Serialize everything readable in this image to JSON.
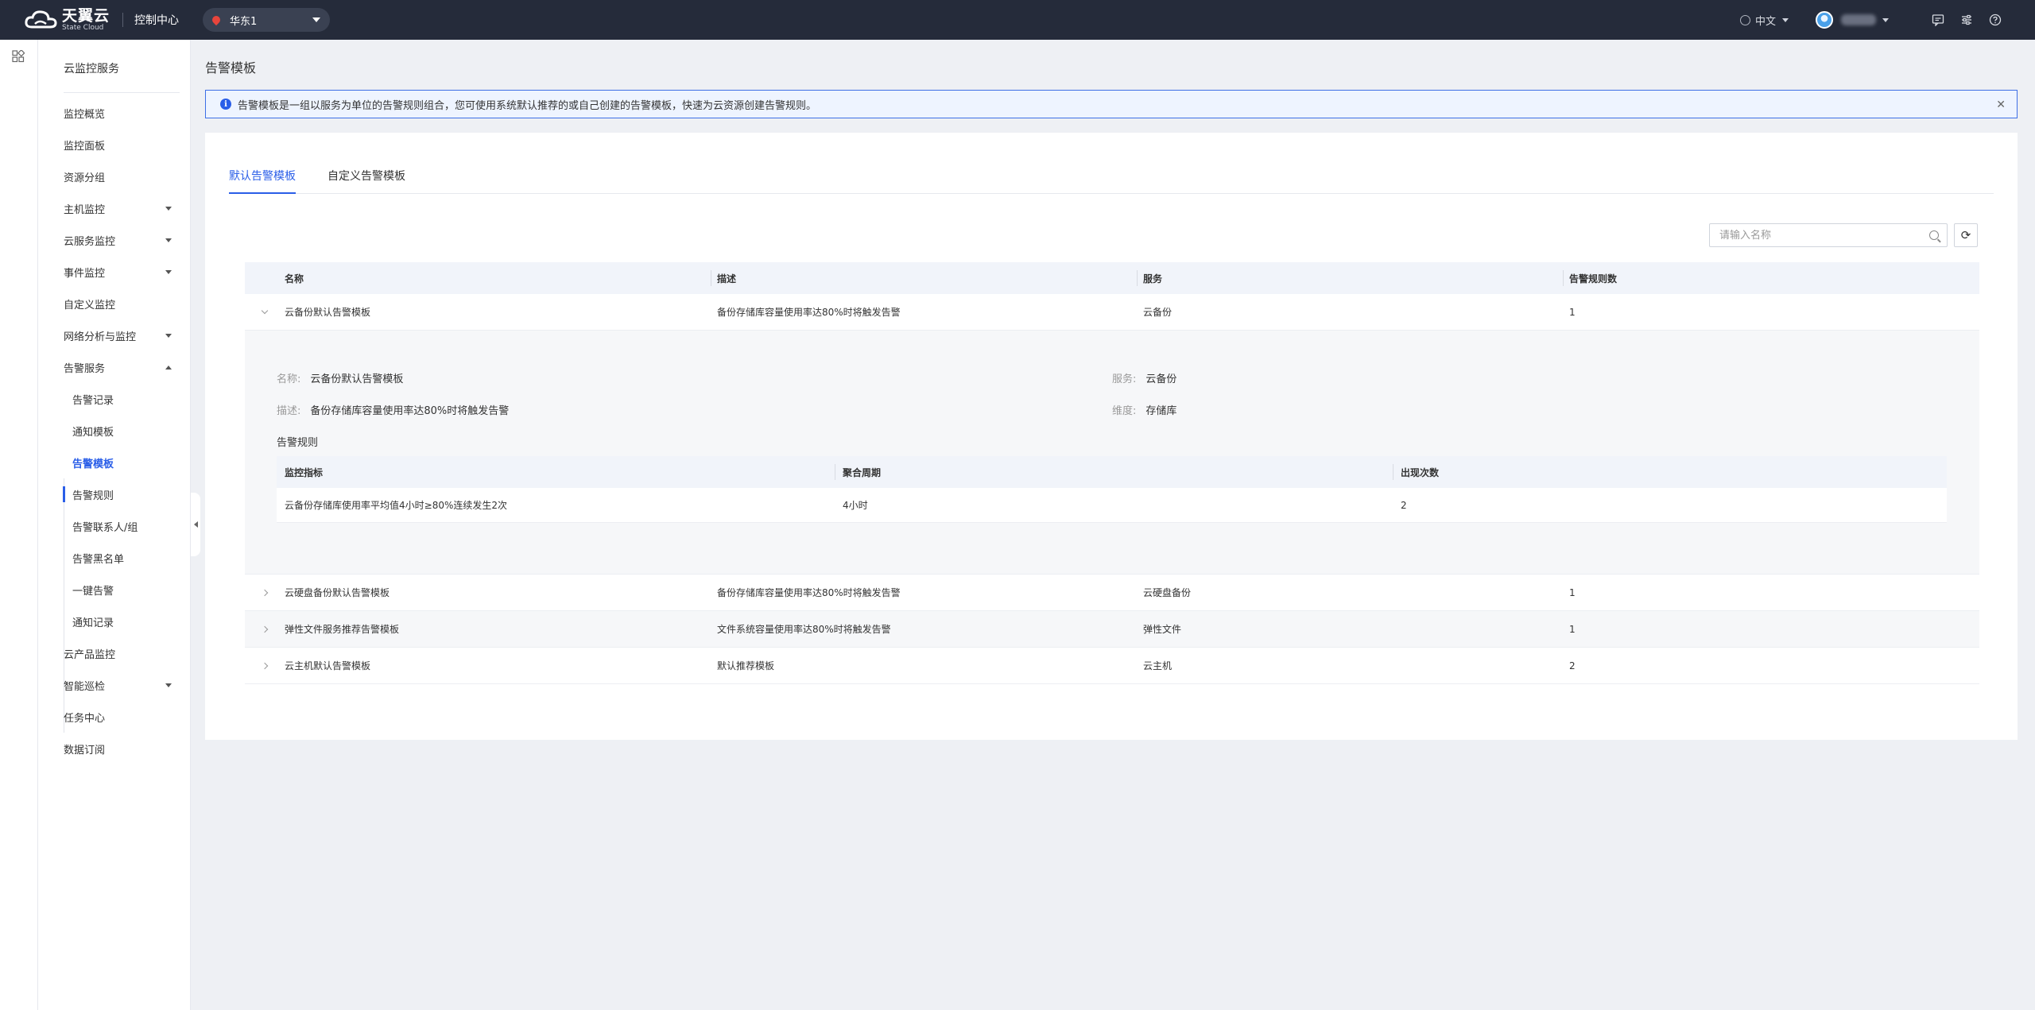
{
  "topbar": {
    "logo_main": "天翼云",
    "logo_sub": "State Cloud",
    "console_title": "控制中心",
    "region": "华东1",
    "language": "中文"
  },
  "sidebar": {
    "title": "云监控服务",
    "items": [
      {
        "label": "监控概览"
      },
      {
        "label": "监控面板"
      },
      {
        "label": "资源分组"
      },
      {
        "label": "主机监控"
      },
      {
        "label": "云服务监控"
      },
      {
        "label": "事件监控"
      },
      {
        "label": "自定义监控"
      },
      {
        "label": "网络分析与监控"
      },
      {
        "label": "告警服务"
      },
      {
        "label": "告警记录"
      },
      {
        "label": "通知模板"
      },
      {
        "label": "告警模板"
      },
      {
        "label": "告警规则"
      },
      {
        "label": "告警联系人/组"
      },
      {
        "label": "告警黑名单"
      },
      {
        "label": "一键告警"
      },
      {
        "label": "通知记录"
      },
      {
        "label": "云产品监控"
      },
      {
        "label": "智能巡检"
      },
      {
        "label": "任务中心"
      },
      {
        "label": "数据订阅"
      }
    ]
  },
  "main": {
    "page_title": "告警模板",
    "notice": "告警模板是一组以服务为单位的告警规则组合，您可使用系统默认推荐的或自己创建的告警模板，快速为云资源创建告警规则。",
    "tabs": [
      {
        "label": "默认告警模板"
      },
      {
        "label": "自定义告警模板"
      }
    ],
    "search_placeholder": "请输入名称",
    "table": {
      "headers": [
        "名称",
        "描述",
        "服务",
        "告警规则数"
      ],
      "rows": [
        {
          "name": "云备份默认告警模板",
          "desc": "备份存储库容量使用率达80%时将触发告警",
          "service": "云备份",
          "count": "1"
        },
        {
          "name": "云硬盘备份默认告警模板",
          "desc": "备份存储库容量使用率达80%时将触发告警",
          "service": "云硬盘备份",
          "count": "1"
        },
        {
          "name": "弹性文件服务推荐告警模板",
          "desc": "文件系统容量使用率达80%时将触发告警",
          "service": "弹性文件",
          "count": "1"
        },
        {
          "name": "云主机默认告警模板",
          "desc": "默认推荐模板",
          "service": "云主机",
          "count": "2"
        }
      ]
    },
    "detail": {
      "name_key": "名称:",
      "name_val": "云备份默认告警模板",
      "service_key": "服务:",
      "service_val": "云备份",
      "desc_key": "描述:",
      "desc_val": "备份存储库容量使用率达80%时将触发告警",
      "dim_key": "维度:",
      "dim_val": "存储库",
      "rules_title": "告警规则",
      "rules_headers": [
        "监控指标",
        "聚合周期",
        "出现次数"
      ],
      "rules_rows": [
        {
          "metric": "云备份存储库使用率平均值4小时≥80%连续发生2次",
          "period": "4小时",
          "times": "2"
        }
      ]
    }
  },
  "colors": {
    "accent": "#2a5ee8",
    "topbar": "#252b3a"
  }
}
